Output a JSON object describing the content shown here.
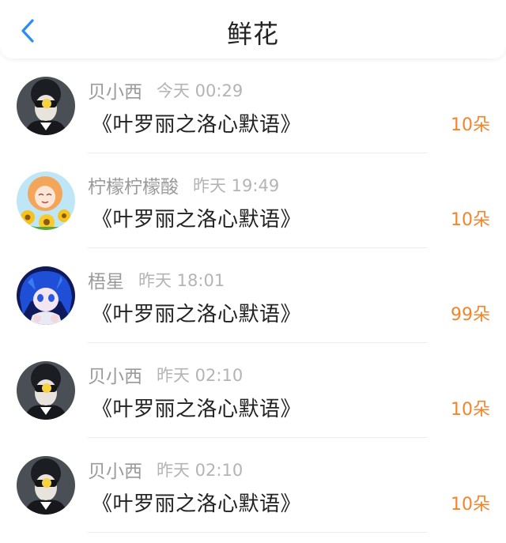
{
  "header": {
    "title": "鲜花",
    "back_icon": "chevron-left-icon"
  },
  "colors": {
    "accent": "#2d8cf0",
    "count": "#f0852a",
    "name": "#9a9a9a",
    "time": "#b4b4b4"
  },
  "items": [
    {
      "avatar": "avatar-dark-girl",
      "name": "贝小西",
      "time": "今天 00:29",
      "gift": "《叶罗丽之洛心默语》",
      "count": "10朵"
    },
    {
      "avatar": "avatar-sunflower-girl",
      "name": "柠檬柠檬酸",
      "time": "昨天 19:49",
      "gift": "《叶罗丽之洛心默语》",
      "count": "10朵"
    },
    {
      "avatar": "avatar-blue-hair",
      "name": "梧星",
      "time": "昨天 18:01",
      "gift": "《叶罗丽之洛心默语》",
      "count": "99朵"
    },
    {
      "avatar": "avatar-dark-girl",
      "name": "贝小西",
      "time": "昨天 02:10",
      "gift": "《叶罗丽之洛心默语》",
      "count": "10朵"
    },
    {
      "avatar": "avatar-dark-girl",
      "name": "贝小西",
      "time": "昨天 02:10",
      "gift": "《叶罗丽之洛心默语》",
      "count": "10朵"
    }
  ]
}
